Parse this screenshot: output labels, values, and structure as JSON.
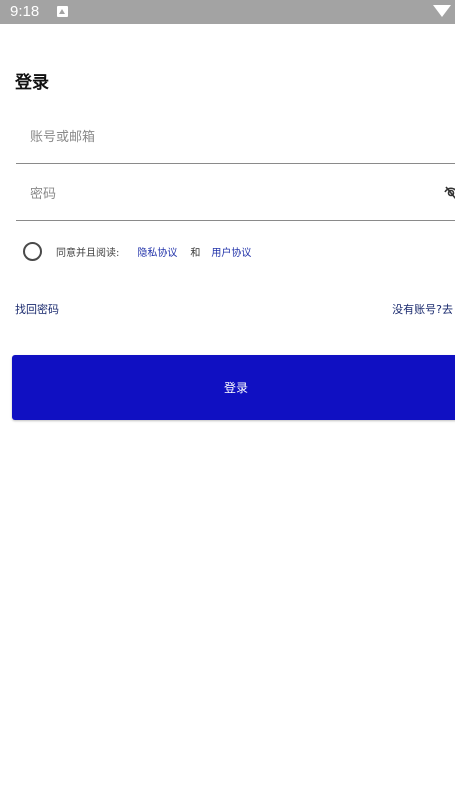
{
  "status_bar": {
    "time": "9:18"
  },
  "login": {
    "title": "登录",
    "account_placeholder": "账号或邮箱",
    "password_placeholder": "密码",
    "agree_prefix": "同意并且阅读:",
    "privacy_link": "隐私协议",
    "and_text": "和",
    "user_agreement_link": "用户协议",
    "forgot_password": "找回密码",
    "register_link": "没有账号?去",
    "submit_label": "登录"
  },
  "colors": {
    "status_bar_bg": "#a3a3a3",
    "primary_button": "#1010c2",
    "link": "#2233aa"
  },
  "icons": {
    "status_notification": "notification-icon",
    "status_wifi": "wifi-icon",
    "password_visibility": "eye-off-icon"
  }
}
